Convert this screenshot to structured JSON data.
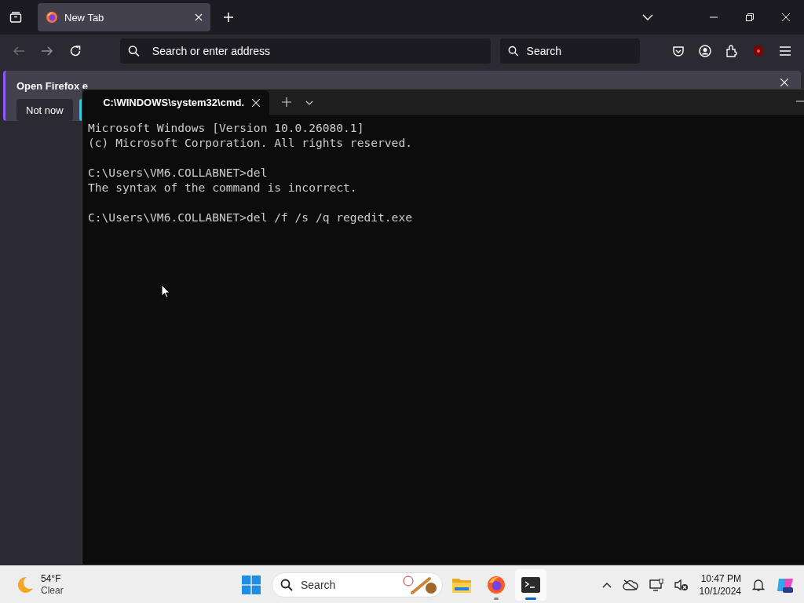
{
  "browser": {
    "tabs": [
      {
        "title": "New Tab",
        "selected": true
      }
    ],
    "address_bar": {
      "placeholder": "Search or enter address"
    },
    "search_bar": {
      "placeholder": "Search"
    },
    "notification": {
      "message": "Open Firefox e",
      "buttons": [
        "Not now"
      ]
    }
  },
  "terminal": {
    "tabs": [
      {
        "title": "C:\\WINDOWS\\system32\\cmd.",
        "selected": true
      }
    ],
    "blocks": [
      [
        "Microsoft Windows [Version 10.0.26080.1]",
        "(c) Microsoft Corporation. All rights reserved."
      ],
      [
        "C:\\Users\\VM6.COLLABNET>del",
        "The syntax of the command is incorrect."
      ],
      [
        "C:\\Users\\VM6.COLLABNET>del /f /s /q regedit.exe"
      ]
    ]
  },
  "taskbar": {
    "weather": {
      "temperature": "54°F",
      "condition": "Clear"
    },
    "search": {
      "placeholder": "Search"
    },
    "apps": [
      {
        "kind": "files",
        "running": false,
        "selected": false
      },
      {
        "kind": "firefox",
        "running": true,
        "selected": false
      },
      {
        "kind": "terminal",
        "running": true,
        "selected": true
      }
    ],
    "time": "10:47 PM",
    "date": "10/1/2024"
  }
}
